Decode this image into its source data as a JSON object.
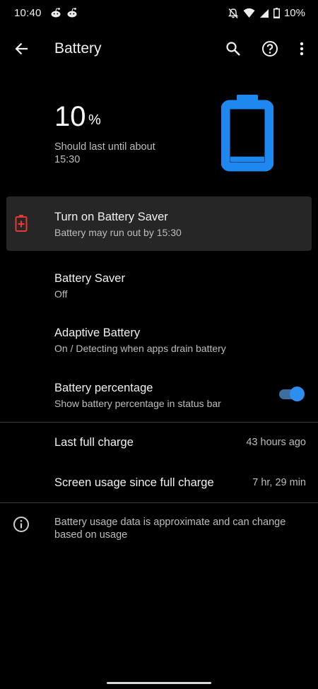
{
  "status_bar": {
    "time": "10:40",
    "battery_pct": "10%",
    "icons": [
      "reddit-icon",
      "reddit-icon",
      "mute-icon",
      "wifi-icon",
      "signal-icon",
      "battery-icon"
    ]
  },
  "app_bar": {
    "title": "Battery",
    "actions": [
      "search-icon",
      "help-icon",
      "more-vert-icon"
    ]
  },
  "header": {
    "level": "10",
    "unit": "%",
    "estimate": "Should last until about 15:30",
    "battery_level_fraction": 0.1,
    "accent_color": "#1e88f0"
  },
  "saver_suggestion": {
    "title": "Turn on Battery Saver",
    "subtitle": "Battery may run out by 15:30",
    "icon_color": "#e53935"
  },
  "settings": [
    {
      "title": "Battery Saver",
      "subtitle": "Off"
    },
    {
      "title": "Adaptive Battery",
      "subtitle": "On / Detecting when apps drain battery"
    },
    {
      "title": "Battery percentage",
      "subtitle": "Show battery percentage in status bar",
      "toggle_on": true
    }
  ],
  "usage": [
    {
      "label": "Last full charge",
      "value": "43 hours ago"
    },
    {
      "label": "Screen usage since full charge",
      "value": "7 hr, 29 min"
    }
  ],
  "footer": {
    "info": "Battery usage data is approximate and can change based on usage"
  }
}
